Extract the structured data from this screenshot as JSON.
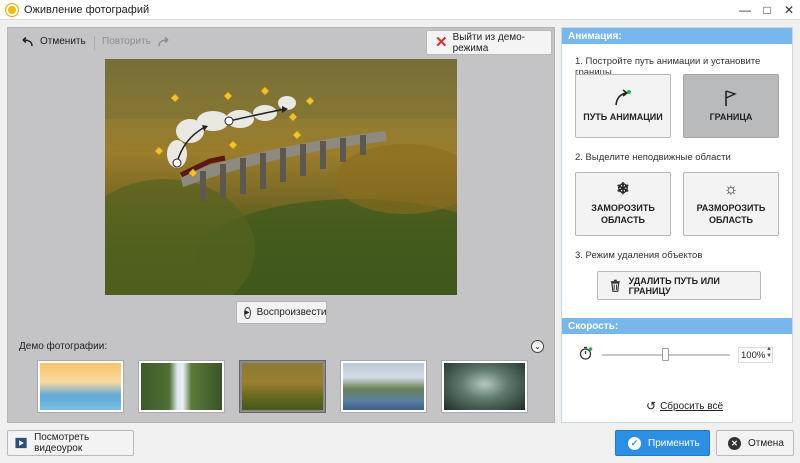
{
  "window": {
    "title": "Оживление фотографий",
    "controls": [
      "minimize-icon",
      "maximize-icon",
      "close-icon"
    ]
  },
  "toolbar": {
    "undo_label": "Отменить",
    "redo_label": "Повторить",
    "exit_demo_label": "Выйти из демо-режима"
  },
  "preview": {
    "play_label": "Воспроизвести"
  },
  "demo": {
    "label": "Демо фотографии:",
    "thumbnails": [
      "beach-couple",
      "waterfall",
      "train-viaduct",
      "river-valley",
      "smoke-abstract"
    ],
    "selected_index": 2
  },
  "animation": {
    "header": "Анимация:",
    "step1": "1. Постройте путь анимации и установите границы",
    "path_button": "ПУТЬ АНИМАЦИИ",
    "border_button": "ГРАНИЦА",
    "border_pressed": true,
    "step2": "2. Выделите неподвижные области",
    "freeze_button": "ЗАМОРОЗИТЬ ОБЛАСТЬ",
    "unfreeze_button": "РАЗМОРОЗИТЬ ОБЛАСТЬ",
    "step3": "3. Режим удаления объектов",
    "delete_button": "УДАЛИТЬ ПУТЬ ИЛИ ГРАНИЦУ"
  },
  "speed": {
    "header": "Скорость:",
    "value": "100%",
    "slider_fraction": 0.48,
    "reset_label": "Сбросить всё"
  },
  "footer": {
    "video_label": "Посмотреть видеоурок",
    "apply_label": "Применить",
    "cancel_label": "Отмена"
  },
  "colors": {
    "accent": "#2d8fe3",
    "section_header": "#77b7ec",
    "exit_icon": "#d63030"
  }
}
